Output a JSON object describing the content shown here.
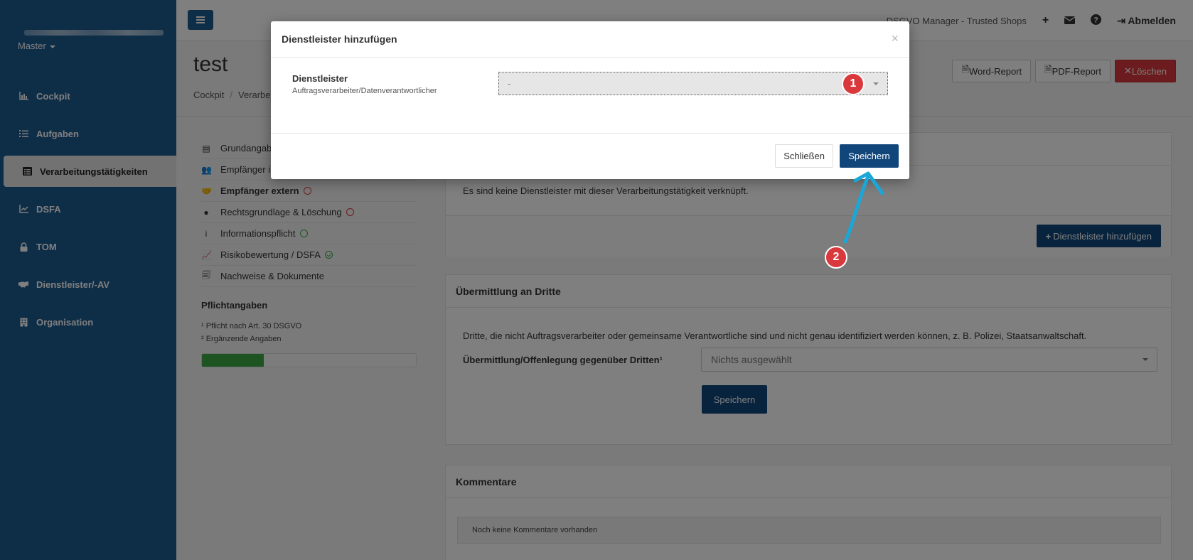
{
  "sidebar": {
    "master_label": "Master",
    "items": [
      {
        "label": "Cockpit",
        "icon": "chart-icon"
      },
      {
        "label": "Aufgaben",
        "icon": "tasks-icon"
      },
      {
        "label": "Verarbeitungstätigkeiten",
        "icon": "list-icon"
      },
      {
        "label": "DSFA",
        "icon": "line-chart-icon"
      },
      {
        "label": "TOM",
        "icon": "lock-icon"
      },
      {
        "label": "Dienstleister/-AV",
        "icon": "handshake-icon"
      },
      {
        "label": "Organisation",
        "icon": "building-icon"
      }
    ]
  },
  "topbar": {
    "brand": "DSGVO Manager - Trusted Shops",
    "logout": "Abmelden"
  },
  "header": {
    "title": "test",
    "breadcrumb": [
      "Cockpit",
      "Verarbe"
    ],
    "buttons": {
      "word": "Word-Report",
      "pdf": "PDF-Report",
      "delete": "Löschen"
    }
  },
  "subnav": {
    "items": [
      {
        "label": "Grundangab",
        "icon": "list-icon"
      },
      {
        "label": "Empfänger i",
        "icon": "users-icon"
      },
      {
        "label": "Empfänger extern",
        "icon": "handshake-icon"
      },
      {
        "label": "Rechtsgrundlage & Löschung",
        "icon": "check-circle-icon"
      },
      {
        "label": "Informationspflicht",
        "icon": "info-icon"
      },
      {
        "label": "Risikobewertung / DSFA",
        "icon": "line-chart-icon"
      },
      {
        "label": "Nachweise & Dokumente",
        "icon": "documents-icon"
      }
    ],
    "pflicht_title": "Pflichtangaben",
    "pflicht_1": "¹ Pflicht nach Art. 30 DSGVO",
    "pflicht_2": "² Ergänzende Angaben",
    "progress": 0.29
  },
  "panel_dienstleister": {
    "empty_text": "Es sind keine Dienstleister mit dieser Verarbeitungstätigkeit verknüpft.",
    "add_button": "Dienstleister hinzufügen"
  },
  "panel_dritte": {
    "title": "Übermittlung an Dritte",
    "description": "Dritte, die nicht Auftragsverarbeiter oder gemeinsame Verantwortliche sind und nicht genau identifiziert werden können, z. B. Polizei, Staatsanwaltschaft.",
    "field_label": "Übermittlung/Offenlegung gegenüber Dritten¹",
    "select_value": "Nichts ausgewählt",
    "save_button": "Speichern"
  },
  "panel_kommentare": {
    "title": "Kommentare",
    "empty_text": "Noch keine Kommentare vorhanden"
  },
  "modal": {
    "title": "Dienstleister hinzufügen",
    "close_glyph": "×",
    "field_label": "Dienstleister",
    "field_sub": "Auftragsverarbeiter/Datenverantwortlicher",
    "select_value": "-",
    "close_button": "Schließen",
    "save_button": "Speichern"
  },
  "annotations": {
    "badge_1": "1",
    "badge_2": "2",
    "badge_color": "#d9383c",
    "arrow_color": "#1aa7d8"
  }
}
